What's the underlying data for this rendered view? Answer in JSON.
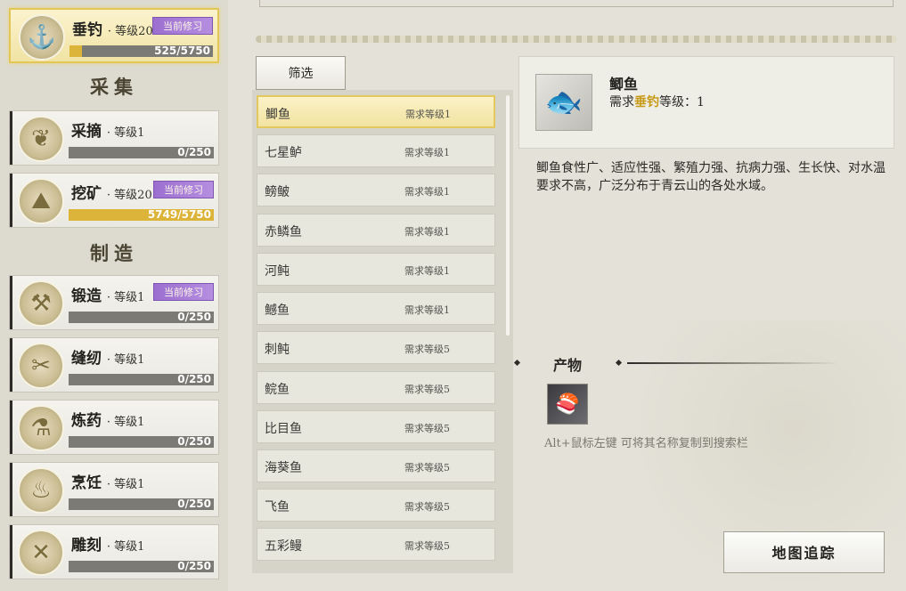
{
  "skills_gather_title": "采集",
  "skills_craft_title": "制造",
  "skills": [
    {
      "name": "垂钓",
      "level": "· 等级20",
      "badge": "当前修习",
      "exp": "525/5750",
      "progress": 0.09,
      "icon": "fishing-icon",
      "active": true
    },
    {
      "name": "采摘",
      "level": "· 等级1",
      "badge": "",
      "exp": "0/250",
      "progress": 0,
      "icon": "herb-icon",
      "active": false
    },
    {
      "name": "挖矿",
      "level": "· 等级20",
      "badge": "当前修习",
      "exp": "5749/5750",
      "progress": 0.999,
      "icon": "ore-icon",
      "active": false
    },
    {
      "name": "锻造",
      "level": "· 等级1",
      "badge": "当前修习",
      "exp": "0/250",
      "progress": 0,
      "icon": "anvil-icon",
      "active": false
    },
    {
      "name": "缝纫",
      "level": "· 等级1",
      "badge": "",
      "exp": "0/250",
      "progress": 0,
      "icon": "thread-icon",
      "active": false
    },
    {
      "name": "炼药",
      "level": "· 等级1",
      "badge": "",
      "exp": "0/250",
      "progress": 0,
      "icon": "gourd-icon",
      "active": false
    },
    {
      "name": "烹饪",
      "level": "· 等级1",
      "badge": "",
      "exp": "0/250",
      "progress": 0,
      "icon": "cooking-icon",
      "active": false
    },
    {
      "name": "雕刻",
      "level": "· 等级1",
      "badge": "",
      "exp": "0/250",
      "progress": 0,
      "icon": "carving-icon",
      "active": false
    }
  ],
  "filter_label": "筛选",
  "fish_list": [
    {
      "name": "鲫鱼",
      "req": "需求等级1"
    },
    {
      "name": "七星鲈",
      "req": "需求等级1"
    },
    {
      "name": "鳑鲏",
      "req": "需求等级1"
    },
    {
      "name": "赤鳞鱼",
      "req": "需求等级1"
    },
    {
      "name": "河鲀",
      "req": "需求等级1"
    },
    {
      "name": "鳡鱼",
      "req": "需求等级1"
    },
    {
      "name": "刺鲀",
      "req": "需求等级5"
    },
    {
      "name": "鲩鱼",
      "req": "需求等级5"
    },
    {
      "name": "比目鱼",
      "req": "需求等级5"
    },
    {
      "name": "海葵鱼",
      "req": "需求等级5"
    },
    {
      "name": "飞鱼",
      "req": "需求等级5"
    },
    {
      "name": "五彩鳗",
      "req": "需求等级5"
    }
  ],
  "detail": {
    "name": "鲫鱼",
    "req_prefix": "需求",
    "req_skill": "垂钓",
    "req_suffix": "等级：1",
    "description": "鲫鱼食性广、适应性强、繁殖力强、抗病力强、生长快、对水温要求不高，广泛分布于青云山的各处水域。",
    "product_title": "产物",
    "hint": "Alt+鼠标左键 可将其名称复制到搜索栏",
    "map_button": "地图追踪"
  },
  "colors": {
    "accent_gold": "#e2c658",
    "badge_purple": "#a97fd9",
    "exp_fill": "#dcb43a"
  }
}
